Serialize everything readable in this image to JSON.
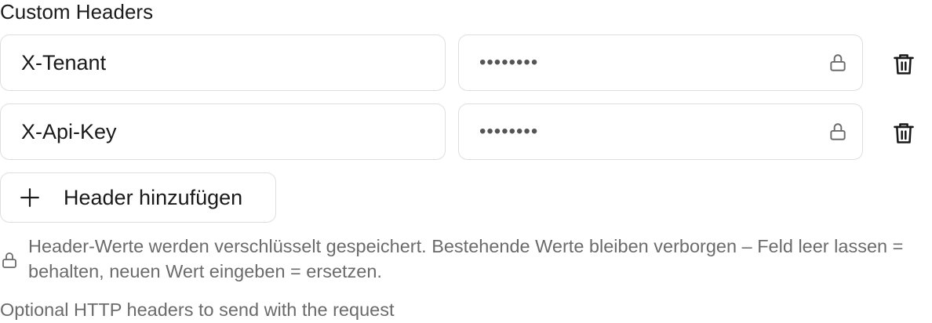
{
  "custom_headers": {
    "title": "Custom Headers",
    "rows": [
      {
        "name": "X-Tenant",
        "value_mask": "••••••••",
        "lock_icon": "lock-icon",
        "delete_icon": "trash-icon"
      },
      {
        "name": "X-Api-Key",
        "value_mask": "••••••••",
        "lock_icon": "lock-icon",
        "delete_icon": "trash-icon"
      }
    ],
    "add_button": {
      "icon": "plus-icon",
      "label": "Header hinzufügen"
    },
    "info": {
      "icon": "lock-icon",
      "text": "Header-Werte werden verschlüsselt gespeichert. Bestehende Werte bleiben verborgen – Feld leer lassen = behalten, neuen Wert eingeben = ersetzen."
    },
    "help_text": "Optional HTTP headers to send with the request"
  },
  "colors": {
    "border": "#dedede",
    "text": "#1a1a1a",
    "muted_text": "#6b6b6b",
    "icon": "#1a1a1a",
    "muted_icon": "#6b6b6b"
  }
}
